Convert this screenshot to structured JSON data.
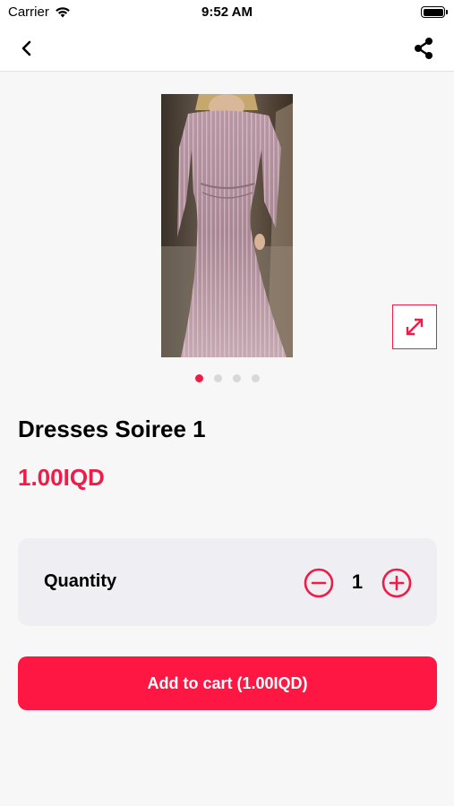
{
  "status_bar": {
    "carrier": "Carrier",
    "time": "9:52 AM"
  },
  "nav": {
    "back_icon": "chevron-left-icon",
    "share_icon": "share-icon"
  },
  "gallery": {
    "image_alt": "pink sequined long-sleeve mermaid evening dress",
    "slide_count": 4,
    "active_slide": 1,
    "expand_icon": "expand-arrows-icon"
  },
  "product": {
    "title": "Dresses Soiree 1",
    "price": "1.00IQD"
  },
  "quantity": {
    "label": "Quantity",
    "value": "1"
  },
  "actions": {
    "add_to_cart_label": "Add to cart (1.00IQD)"
  },
  "colors": {
    "accent": "#ee1c47",
    "button": "#ff1744",
    "background": "#f7f7f7",
    "card": "#efeff3"
  }
}
